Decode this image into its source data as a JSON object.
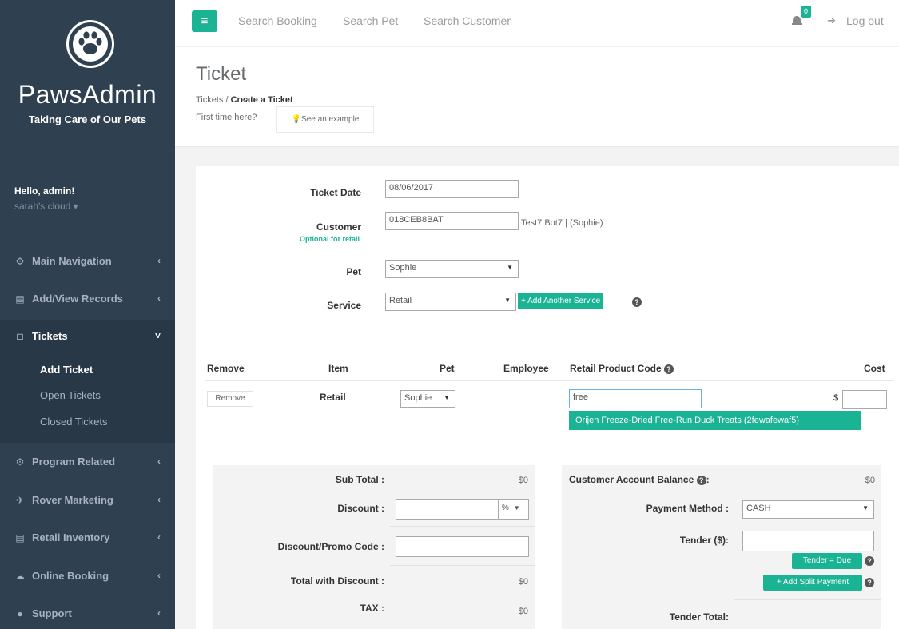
{
  "sidebar": {
    "brand": "PawsAdmin",
    "tagline": "Taking Care of Our Pets",
    "greeting": "Hello, admin!",
    "account": "sarah's cloud ▾",
    "nav": [
      {
        "label": "Main Navigation",
        "icon": "dashboard-icon",
        "chevron": "‹"
      },
      {
        "label": "Add/View Records",
        "icon": "records-icon",
        "chevron": "‹"
      },
      {
        "label": "Tickets",
        "icon": "ticket-icon",
        "chevron": "˅"
      },
      {
        "label": "Program Related",
        "icon": "gear-icon",
        "chevron": "‹"
      },
      {
        "label": "Rover Marketing",
        "icon": "megaphone-icon",
        "chevron": "‹"
      },
      {
        "label": "Retail Inventory",
        "icon": "cart-icon",
        "chevron": "‹"
      },
      {
        "label": "Online Booking",
        "icon": "cloud-icon",
        "chevron": "‹"
      },
      {
        "label": "Support",
        "icon": "chat-icon",
        "chevron": "‹"
      }
    ],
    "tickets_sub": [
      "Add Ticket",
      "Open Tickets",
      "Closed Tickets"
    ]
  },
  "topbar": {
    "menu_icon": "≡",
    "links": [
      "Search Booking",
      "Search Pet",
      "Search Customer"
    ],
    "notification_count": "0",
    "logout": "Log out"
  },
  "heading": {
    "title": "Ticket",
    "breadcrumb_root": "Tickets /",
    "breadcrumb_current": "Create a Ticket",
    "first_time": "First time here?",
    "example_btn": "💡See an example"
  },
  "form": {
    "ticket_date_label": "Ticket Date",
    "ticket_date_value": "08/06/2017",
    "customer_label": "Customer",
    "customer_hint": "Optional for retail",
    "customer_value": "018CEB8BAT",
    "customer_name": "Test7 Bot7 | (Sophie)",
    "pet_label": "Pet",
    "pet_value": "Sophie",
    "service_label": "Service",
    "service_value": "Retail",
    "add_service_btn": "+ Add Another Service"
  },
  "table": {
    "headers": [
      "Remove",
      "Item",
      "Pet",
      "Employee",
      "Retail Product Code",
      "Cost"
    ],
    "row": {
      "remove_btn": "Remove",
      "item": "Retail",
      "pet": "Sophie",
      "product_code": "free",
      "currency": "$",
      "cost": ""
    },
    "suggestion": "Orijen Freeze-Dried Free-Run Duck Treats (2fewafewaf5)"
  },
  "summary_left": {
    "rows": [
      {
        "label": "Sub Total :",
        "value": "$0"
      },
      {
        "label": "Discount :",
        "value": ""
      },
      {
        "label": "Discount/Promo Code :",
        "value": ""
      },
      {
        "label": "Total with Discount :",
        "value": "$0"
      },
      {
        "label": "TAX :",
        "value": "$0"
      }
    ],
    "discount_unit": "%"
  },
  "summary_right": {
    "balance_label": "Customer Account Balance",
    "balance_value": "$0",
    "payment_label": "Payment Method :",
    "payment_value": "CASH",
    "tender_label": "Tender ($):",
    "tender_due_btn": "Tender = Due",
    "split_btn": "+ Add Split Payment",
    "tender_total_label": "Tender Total:"
  },
  "colors": {
    "accent": "#1ab394",
    "sidebar": "#2f4050"
  }
}
